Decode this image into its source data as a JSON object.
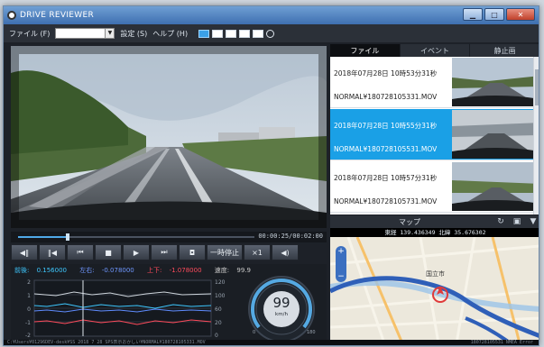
{
  "window": {
    "title": "DRIVE REVIEWER"
  },
  "menu": {
    "file": "ファイル (F)",
    "settings": "設定 (S)",
    "help": "ヘルプ (H)"
  },
  "player": {
    "timecode": "00:00:25/00:02:00",
    "progress_fraction": 0.21,
    "pause_label": "一時停止",
    "speed_label": "×1"
  },
  "sensor": {
    "front_back_label": "前後:",
    "front_back_value": "0.156000",
    "left_right_label": "左右:",
    "left_right_value": "-0.078000",
    "up_down_label": "上下:",
    "up_down_value": "-1.078000",
    "speed_label": "速度:",
    "speed_value": "99.9",
    "speedometer_value": "99",
    "speedometer_unit": "km/h",
    "colors": {
      "front_back": "#3ec8ff",
      "left_right": "#5f8cff",
      "up_down": "#ff4b5c",
      "speed": "#d0d0d0"
    }
  },
  "tabs": [
    {
      "label": "ファイル",
      "active": true
    },
    {
      "label": "イベント",
      "active": false
    },
    {
      "label": "静止画",
      "active": false
    }
  ],
  "files": [
    {
      "date": "2018年07月28日 10時53分31秒",
      "name": "NORMAL¥180728105331.MOV",
      "selected": false
    },
    {
      "date": "2018年07月28日 10時55分31秒",
      "name": "NORMAL¥180728105531.MOV",
      "selected": true
    },
    {
      "date": "2018年07月28日 10時57分31秒",
      "name": "NORMAL¥180728105731.MOV",
      "selected": false
    }
  ],
  "map": {
    "title": "マップ",
    "coords": "東経 139.436349  北緯 35.676302",
    "place_label": "国立市"
  },
  "statusbar": {
    "left": "C:¥Users¥01296DEV-desk¥SS 2018 7 28 SPS表示おかしい¥NORMAL¥180728105331.MOV",
    "right": "180728105531 NMEA Error"
  },
  "icons": {
    "app": "app-icon",
    "minimize": "minimize-icon",
    "maximize": "maximize-icon",
    "close": "close-icon"
  }
}
